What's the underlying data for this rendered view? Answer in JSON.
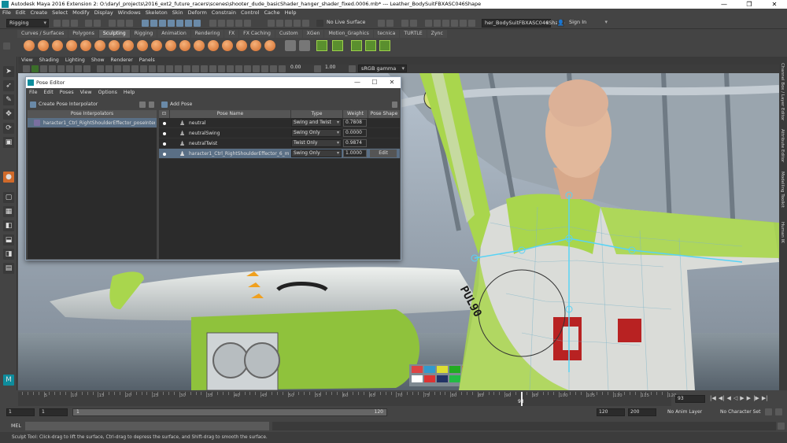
{
  "window": {
    "title": "Autodesk Maya 2016 Extension 2: O:\\daryl_projects\\2016_ext2_future_racers\\scenes\\shooter_dude_basicShader_hanger_shader_fixed.0006.mb*   ---   Leather_BodySuitFBXASC046Shape",
    "controls": [
      "—",
      "❐",
      "✕"
    ]
  },
  "menubar": [
    "File",
    "Edit",
    "Create",
    "Select",
    "Modify",
    "Display",
    "Windows",
    "Skeleton",
    "Skin",
    "Deform",
    "Constrain",
    "Control",
    "Cache",
    "Help"
  ],
  "statusline": {
    "menuset": "Rigging",
    "live_surface": "No Live Surface",
    "object_field": "her_BodySuitFBXASC046Shape",
    "sign_in": "Sign In"
  },
  "shelf_tabs": [
    "Curves / Surfaces",
    "Polygons",
    "Sculpting",
    "Rigging",
    "Animation",
    "Rendering",
    "FX",
    "FX Caching",
    "Custom",
    "XGen",
    "Motion_Graphics",
    "tecnica",
    "TURTLE",
    "Zync"
  ],
  "shelf_active": "Sculpting",
  "viewport": {
    "menu": [
      "View",
      "Shading",
      "Lighting",
      "Show",
      "Renderer",
      "Panels"
    ],
    "exposure": "0.00",
    "gamma": "1.00",
    "color_space": "sRGB gamma",
    "decal_text": "PUL90"
  },
  "right_tabs": [
    "Channel Box / Layer Editor",
    "Attribute Editor",
    "Modelling Toolkit",
    "Human IK"
  ],
  "pose_editor": {
    "title": "Pose Editor",
    "controls": [
      "—",
      "☐",
      "✕"
    ],
    "menu": [
      "File",
      "Edit",
      "Poses",
      "View",
      "Options",
      "Help"
    ],
    "create_button": "Create Pose Interpolator",
    "interpolators_header": "Pose Interpolators",
    "interpolators": [
      {
        "name": "haracter1_Ctrl_RightShoulderEffector_poseInterpolat"
      }
    ],
    "add_pose_button": "Add Pose",
    "columns": [
      "Pose Name",
      "Type",
      "Weight",
      "Pose Shape"
    ],
    "poses": [
      {
        "name": "neutral",
        "type": "Swing and Twist",
        "weight": "0.7808",
        "shape": ""
      },
      {
        "name": "neutralSwing",
        "type": "Swing Only",
        "weight": "0.0000",
        "shape": ""
      },
      {
        "name": "neutralTwist",
        "type": "Twist Only",
        "weight": "0.9874",
        "shape": ""
      },
      {
        "name": "haracter1_Ctrl_RightShoulderEffector_6_m75_n1",
        "type": "Swing Only",
        "weight": "1.0000",
        "shape": "Edit"
      }
    ]
  },
  "timeline": {
    "ticks": [
      "5",
      "10",
      "15",
      "20",
      "25",
      "30",
      "35",
      "40",
      "45",
      "50",
      "55",
      "60",
      "65",
      "70",
      "75",
      "80",
      "85",
      "90",
      "95",
      "100",
      "105",
      "110",
      "115",
      "120"
    ],
    "current_frame": "93",
    "current_frame_field": "93"
  },
  "range": {
    "start": "1",
    "playback_start": "1",
    "range_start_label": "1",
    "range_end_label": "120",
    "playback_end": "120",
    "end": "200",
    "anim_layer": "No Anim Layer",
    "character_set": "No Character Set"
  },
  "mel_label": "MEL",
  "help_text": "Sculpt Tool: Click-drag to lift the surface, Ctrl-drag to depress the surface, and Shift-drag to smooth the surface.",
  "colors": {
    "maya_teal": "#0e8c9c",
    "accent_green": "#9cd04b",
    "selection_blue": "#5a6f85"
  }
}
